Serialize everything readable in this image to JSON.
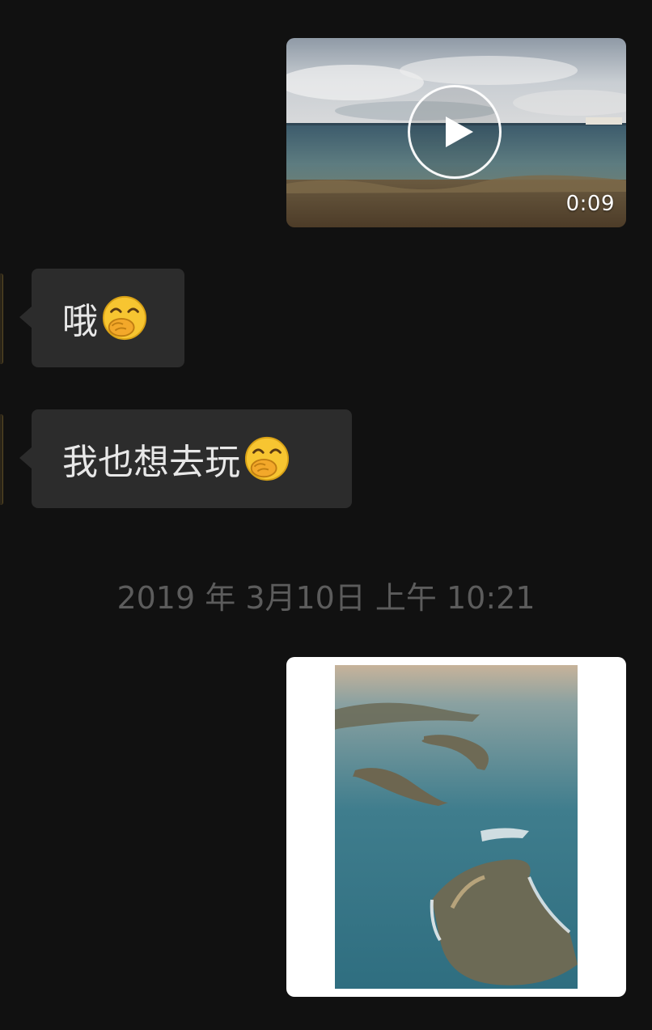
{
  "messages": {
    "video": {
      "duration": "0:09",
      "icon": "play-icon"
    },
    "reply_1": {
      "text": "哦",
      "emoji": "hand-over-mouth-emoji"
    },
    "reply_2": {
      "text": "我也想去玩",
      "emoji": "hand-over-mouth-emoji"
    },
    "timestamp": "2019 年 3月10日 上午 10:21",
    "image": {
      "icon": "aerial-islands-photo"
    }
  },
  "colors": {
    "background": "#111111",
    "bubble_incoming": "#2c2c2c",
    "bubble_text": "#e8e8e8",
    "timestamp_text": "#5c5c5c",
    "image_frame": "#ffffff"
  }
}
